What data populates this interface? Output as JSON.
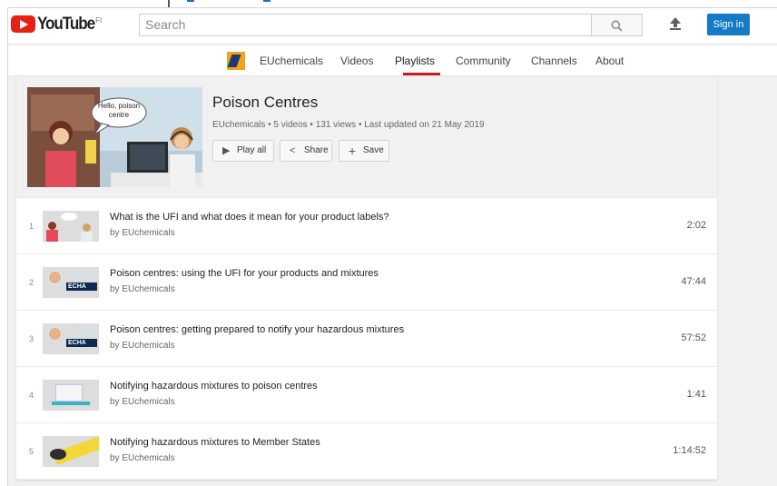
{
  "masthead": {
    "logo_text": "YouTube",
    "logo_region": "FI",
    "search_placeholder": "Search",
    "signin_label": "Sign in"
  },
  "channel_nav": {
    "channel_name": "EUchemicals",
    "tabs": [
      "Videos",
      "Playlists",
      "Community",
      "Channels",
      "About"
    ],
    "active_tab": "Playlists"
  },
  "playlist": {
    "hero_bubble": "Hello, poison centre",
    "title": "Poison Centres",
    "meta": "EUchemicals • 5 videos • 131 views • Last updated on 21 May 2019",
    "buttons": {
      "play_all": "Play all",
      "share": "Share",
      "save": "Save"
    },
    "videos": [
      {
        "index": "1",
        "title": "What is the UFI and what does it mean for your product labels?",
        "by": "by EUchemicals",
        "duration": "2:02",
        "thumb": "cartoon"
      },
      {
        "index": "2",
        "title": "Poison centres: using the UFI for your products and mixtures",
        "by": "by EUchemicals",
        "duration": "47:44",
        "thumb": "webinar"
      },
      {
        "index": "3",
        "title": "Poison centres: getting prepared to notify your hazardous mixtures",
        "by": "by EUchemicals",
        "duration": "57:52",
        "thumb": "webinar"
      },
      {
        "index": "4",
        "title": "Notifying hazardous mixtures to poison centres",
        "by": "by EUchemicals",
        "duration": "1:41",
        "thumb": "purple"
      },
      {
        "index": "5",
        "title": "Notifying hazardous mixtures to Member States",
        "by": "by EUchemicals",
        "duration": "1:14:52",
        "thumb": "ms"
      }
    ],
    "webinar_thumb_text": {
      "top": "WEBINARS",
      "bottom": "ECHA"
    }
  },
  "colors": {
    "brand_red": "#e62117",
    "signin_blue": "#167ac6",
    "active_tab_underline": "#cc181e"
  }
}
